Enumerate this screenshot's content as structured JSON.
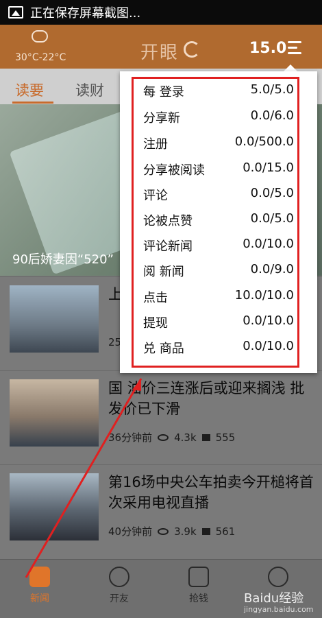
{
  "status_bar": {
    "text": "正在保存屏幕截图..."
  },
  "header": {
    "temperature": "30°C-22°C",
    "title": "开眼",
    "score": "15.0"
  },
  "tabs": [
    {
      "label": "读要",
      "active": true
    },
    {
      "label": "读财",
      "active": false
    }
  ],
  "hero": {
    "caption": "90后娇妻因“520”"
  },
  "news": [
    {
      "headline": "上 饥",
      "time": "25",
      "views": "",
      "comments": ""
    },
    {
      "headline": "国 油价三连涨后或迎来搁浅 批发价已下滑",
      "time": "36分钟前",
      "views": "4.3k",
      "comments": "555"
    },
    {
      "headline": "第16场中央公车拍卖今开槌将首次采用电视直播",
      "time": "40分钟前",
      "views": "3.9k",
      "comments": "561"
    }
  ],
  "popup": {
    "rows": [
      {
        "label": "每 登录",
        "value": "5.0/5.0"
      },
      {
        "label": "分享新",
        "value": "0.0/6.0"
      },
      {
        "label": "注册",
        "value": "0.0/500.0"
      },
      {
        "label": "分享被阅读",
        "value": "0.0/15.0"
      },
      {
        "label": "评论",
        "value": "0.0/5.0"
      },
      {
        "label": "论被点赞",
        "value": "0.0/5.0"
      },
      {
        "label": "评论新闻",
        "value": "0.0/10.0"
      },
      {
        "label": "阅 新闻",
        "value": "0.0/9.0"
      },
      {
        "label": "点击",
        "value": "10.0/10.0"
      },
      {
        "label": "提现",
        "value": "0.0/10.0"
      },
      {
        "label": "兑 商品",
        "value": "0.0/10.0"
      }
    ]
  },
  "tabbar": [
    {
      "label": "新闻",
      "active": true
    },
    {
      "label": "开友",
      "active": false
    },
    {
      "label": "抢钱",
      "active": false
    }
  ],
  "watermark": {
    "text": "Baidu经验",
    "sub": "jingyan.baidu.com"
  },
  "colors": {
    "accent": "#e0752a",
    "header": "#b06a2f",
    "annotation": "#e02020"
  }
}
